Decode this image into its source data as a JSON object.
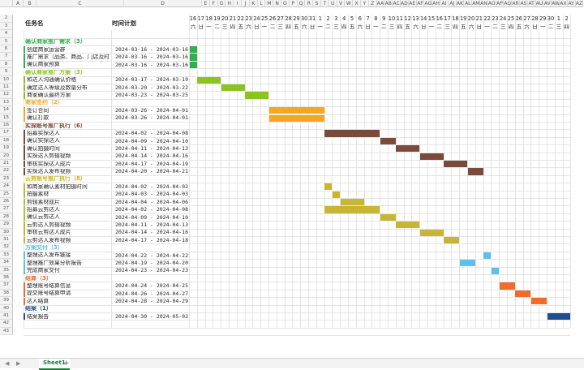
{
  "col_letters": [
    "A",
    "B",
    "C",
    "D",
    "E",
    "F",
    "G",
    "H",
    "I",
    "J",
    "K",
    "L",
    "M",
    "N",
    "O",
    "P",
    "Q",
    "R",
    "S",
    "T",
    "U",
    "V",
    "W",
    "X",
    "Y",
    "Z",
    "AA",
    "AB",
    "AC",
    "AD",
    "AE",
    "AF",
    "AG",
    "AH",
    "AI",
    "AJ",
    "AK",
    "AL",
    "AM",
    "AN",
    "AO",
    "AP",
    "AQ",
    "AR",
    "AS",
    "AT",
    "AU",
    "AV",
    "AW",
    "AX",
    "AY",
    "AZ"
  ],
  "header": {
    "task_label": "任务名",
    "plan_label": "时间计划"
  },
  "day_numbers": [
    "16",
    "17",
    "18",
    "19",
    "20",
    "21",
    "22",
    "23",
    "24",
    "25",
    "26",
    "27",
    "28",
    "29",
    "30",
    "31",
    "1",
    "2",
    "3",
    "4",
    "5",
    "6",
    "7",
    "8",
    "9",
    "10",
    "11",
    "12",
    "13",
    "14",
    "15",
    "16",
    "17",
    "18",
    "19",
    "20",
    "21",
    "22",
    "23",
    "24",
    "25",
    "26",
    "27",
    "28",
    "29",
    "30",
    "1",
    "2"
  ],
  "weekdays": [
    "六",
    "日",
    "一",
    "二",
    "三",
    "四",
    "五",
    "六",
    "日",
    "一",
    "二",
    "三",
    "四",
    "五",
    "六",
    "日",
    "一",
    "二",
    "三",
    "四",
    "五",
    "六",
    "日",
    "一",
    "二",
    "三",
    "四",
    "五",
    "六",
    "日",
    "一",
    "二",
    "三",
    "四",
    "五",
    "六",
    "日",
    "一",
    "二",
    "三",
    "四",
    "五",
    "六",
    "日",
    "一",
    "二",
    "三",
    "四"
  ],
  "rows": [
    {
      "row": 5,
      "type": "section",
      "label": "确认商家推广需求（3）",
      "color": "#2db14c"
    },
    {
      "row": 6,
      "type": "task",
      "label": "创建商家运营群",
      "dates": "2024-03-16 - 2024-03-16",
      "color": "#2db14c",
      "start": 0,
      "len": 1
    },
    {
      "row": 7,
      "type": "task",
      "label": "推广需求（品类、商品、门店及时",
      "dates": "2024-03-16 - 2024-03-16",
      "color": "#2db14c",
      "start": 0,
      "len": 1
    },
    {
      "row": 8,
      "type": "task",
      "label": "确认商家预算",
      "dates": "2024-03-16 - 2024-03-16",
      "color": "#2db14c",
      "start": 0,
      "len": 1
    },
    {
      "row": 9,
      "type": "section",
      "label": "确认商家推广方案（3）",
      "color": "#8bc41f"
    },
    {
      "row": 10,
      "type": "task",
      "label": "和达人沟通确认价格",
      "dates": "2024-03-17 - 2024-03-19",
      "color": "#8bc41f",
      "start": 1,
      "len": 3
    },
    {
      "row": 11,
      "type": "task",
      "label": "确定达人等级及数量分布",
      "dates": "2024-03-20 - 2024-03-22",
      "color": "#8bc41f",
      "start": 4,
      "len": 3
    },
    {
      "row": 12,
      "type": "task",
      "label": "商家确认最终方案",
      "dates": "2024-03-23 - 2024-03-25",
      "color": "#8bc41f",
      "start": 7,
      "len": 3
    },
    {
      "row": 13,
      "type": "section",
      "label": "商家签约（2）",
      "color": "#f5a623"
    },
    {
      "row": 14,
      "type": "task",
      "label": "签订合同",
      "dates": "2024-03-26 - 2024-04-01",
      "color": "#f5a623",
      "start": 10,
      "len": 7
    },
    {
      "row": 15,
      "type": "task",
      "label": "确认打款",
      "dates": "2024-03-26 - 2024-04-01",
      "color": "#f5a623",
      "start": 10,
      "len": 7
    },
    {
      "row": 16,
      "type": "section",
      "label": "实探账号推广执行（6）",
      "color": "#7a4a3a"
    },
    {
      "row": 17,
      "type": "task",
      "label": "招募实探达人",
      "dates": "2024-04-02 - 2024-04-08",
      "color": "#7a4a3a",
      "start": 17,
      "len": 7
    },
    {
      "row": 18,
      "type": "task",
      "label": "确认实探达人",
      "dates": "2024-04-09 - 2024-04-10",
      "color": "#7a4a3a",
      "start": 24,
      "len": 2
    },
    {
      "row": 19,
      "type": "task",
      "label": "确认拍摄时间",
      "dates": "2024-04-11 - 2024-04-13",
      "color": "#7a4a3a",
      "start": 26,
      "len": 3
    },
    {
      "row": 20,
      "type": "task",
      "label": "实探达人剪辑视频",
      "dates": "2024-04-14 - 2024-04-16",
      "color": "#7a4a3a",
      "start": 29,
      "len": 3
    },
    {
      "row": 21,
      "type": "task",
      "label": "审核实探达人成片",
      "dates": "2024-04-17 - 2024-04-19",
      "color": "#7a4a3a",
      "start": 32,
      "len": 3
    },
    {
      "row": 22,
      "type": "task",
      "label": "实探达人发布视频",
      "dates": "2024-04-20 - 2024-04-21",
      "color": "#7a4a3a",
      "start": 35,
      "len": 2
    },
    {
      "row": 23,
      "type": "section",
      "label": "云剪账号推广执行（8）",
      "color": "#c8b534"
    },
    {
      "row": 24,
      "type": "task",
      "label": "和商家确认素材拍摄时间",
      "dates": "2024-04-02 - 2024-04-02",
      "color": "#c8b534",
      "start": 17,
      "len": 1
    },
    {
      "row": 25,
      "type": "task",
      "label": "拍摄素材",
      "dates": "2024-04-03 - 2024-04-03",
      "color": "#c8b534",
      "start": 18,
      "len": 1
    },
    {
      "row": 26,
      "type": "task",
      "label": "剪辑素材成片",
      "dates": "2024-04-04 - 2024-04-06",
      "color": "#c8b534",
      "start": 19,
      "len": 3
    },
    {
      "row": 27,
      "type": "task",
      "label": "招募云剪达人",
      "dates": "2024-04-02 - 2024-04-08",
      "color": "#c8b534",
      "start": 17,
      "len": 7
    },
    {
      "row": 28,
      "type": "task",
      "label": "确认云剪达人",
      "dates": "2024-04-09 - 2024-04-10",
      "color": "#c8b534",
      "start": 24,
      "len": 2
    },
    {
      "row": 29,
      "type": "task",
      "label": "云剪达人剪辑视频",
      "dates": "2024-04-11 - 2024-04-13",
      "color": "#c8b534",
      "start": 26,
      "len": 3
    },
    {
      "row": 30,
      "type": "task",
      "label": "审核云剪达人成片",
      "dates": "2024-04-14 - 2024-04-16",
      "color": "#c8b534",
      "start": 29,
      "len": 3
    },
    {
      "row": 31,
      "type": "task",
      "label": "云剪达人发布视频",
      "dates": "2024-04-17 - 2024-04-18",
      "color": "#c8b534",
      "start": 32,
      "len": 2
    },
    {
      "row": 32,
      "type": "section",
      "label": "方案交付（3）",
      "color": "#5bc0eb"
    },
    {
      "row": 33,
      "type": "task",
      "label": "整理达人发布链接",
      "dates": "2024-04-22 - 2024-04-22",
      "color": "#5bc0eb",
      "start": 37,
      "len": 1
    },
    {
      "row": 34,
      "type": "task",
      "label": "整理推广效果分析报告",
      "dates": "2024-04-19 - 2024-04-20",
      "color": "#5bc0eb",
      "start": 34,
      "len": 2
    },
    {
      "row": 35,
      "type": "task",
      "label": "完成商家交付",
      "dates": "2024-04-23 - 2024-04-23",
      "color": "#5bc0eb",
      "start": 38,
      "len": 1
    },
    {
      "row": 36,
      "type": "section",
      "label": "结算（3）",
      "color": "#f26b2a"
    },
    {
      "row": 37,
      "type": "task",
      "label": "整理账号结算信息",
      "dates": "2024-04-24 - 2024-04-25",
      "color": "#f26b2a",
      "start": 39,
      "len": 2
    },
    {
      "row": 38,
      "type": "task",
      "label": "提交账号结算申请",
      "dates": "2024-04-26 - 2024-04-27",
      "color": "#f26b2a",
      "start": 41,
      "len": 2
    },
    {
      "row": 39,
      "type": "task",
      "label": "达人结算",
      "dates": "2024-04-28 - 2024-04-29",
      "color": "#f26b2a",
      "start": 43,
      "len": 2
    },
    {
      "row": 40,
      "type": "section",
      "label": "结案（1）",
      "color": "#1f4e8c"
    },
    {
      "row": 41,
      "type": "task",
      "label": "结案报告",
      "dates": "2024-04-30 - 2024-05-02",
      "color": "#1f4e8c",
      "start": 45,
      "len": 3
    }
  ],
  "sheet_tab": "Sheet1",
  "add_sheet": "+",
  "nav_prev": "◀",
  "nav_next": "▶"
}
